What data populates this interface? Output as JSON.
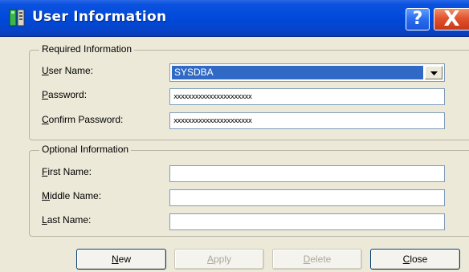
{
  "window": {
    "title": "User Information",
    "title_icon": "server-app-icon",
    "help_button": "?",
    "close_button": "X"
  },
  "required": {
    "legend": "Required Information",
    "username": {
      "label_first": "U",
      "label_rest": "ser Name:",
      "value": "SYSDBA"
    },
    "password": {
      "label_first": "P",
      "label_rest": "assword:",
      "mask": "xxxxxxxxxxxxxxxxxxxxxx"
    },
    "confirm_password": {
      "label_first": "C",
      "label_rest": "onfirm Password:",
      "mask": "xxxxxxxxxxxxxxxxxxxxxx"
    }
  },
  "optional": {
    "legend": "Optional Information",
    "first_name": {
      "label_first": "F",
      "label_rest": "irst Name:",
      "value": ""
    },
    "middle_name": {
      "label_first": "M",
      "label_rest": "iddle Name:",
      "value": ""
    },
    "last_name": {
      "label_first": "L",
      "label_rest": "ast Name:",
      "value": ""
    }
  },
  "buttons": {
    "new": {
      "first": "N",
      "rest": "ew",
      "enabled": true
    },
    "apply": {
      "first": "A",
      "rest": "pply",
      "enabled": false
    },
    "delete": {
      "first": "D",
      "rest": "elete",
      "enabled": false
    },
    "close": {
      "first": "C",
      "rest": "lose",
      "enabled": true
    }
  },
  "colors": {
    "title_bar": "#0048d8",
    "selection": "#316ac5",
    "window_bg": "#ece9d8",
    "close_button": "#e2542d"
  }
}
